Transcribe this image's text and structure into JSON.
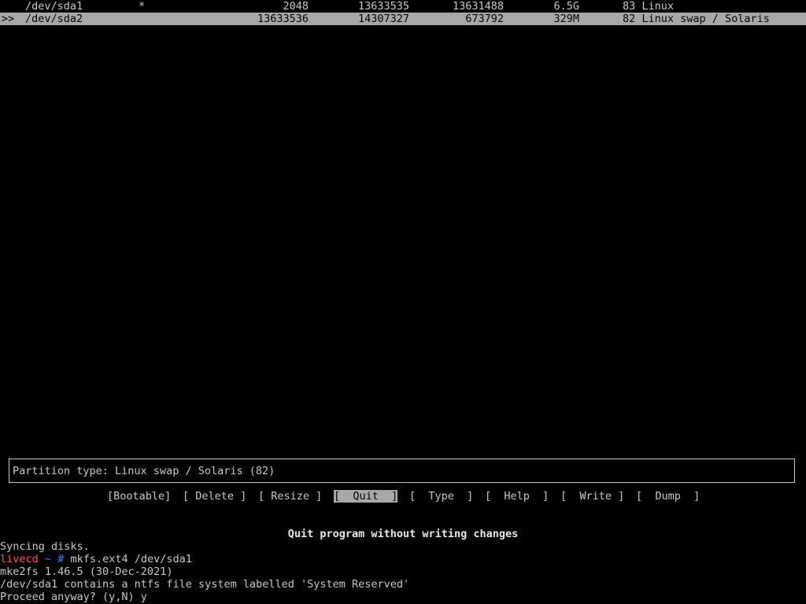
{
  "table": {
    "rows": [
      {
        "cursor": "",
        "device": "/dev/sda1",
        "boot": "*",
        "start": "2048",
        "end": "13633535",
        "sectors": "13631488",
        "size": "6.5G",
        "id_type": "83 Linux",
        "selected": false
      },
      {
        "cursor": ">>",
        "device": "/dev/sda2",
        "boot": "",
        "start": "13633536",
        "end": "14307327",
        "sectors": "673792",
        "size": "329M",
        "id_type": "82 Linux swap / Solaris",
        "selected": true
      }
    ]
  },
  "info": {
    "partition_type": "Partition type: Linux swap / Solaris (82)"
  },
  "menu": {
    "items": [
      {
        "label": "[Bootable]",
        "active": false
      },
      {
        "label": "[ Delete ]",
        "active": false
      },
      {
        "label": "[ Resize ]",
        "active": false
      },
      {
        "label": "[  Quit  ]",
        "active": true
      },
      {
        "label": "[  Type  ]",
        "active": false
      },
      {
        "label": "[  Help  ]",
        "active": false
      },
      {
        "label": "[  Write ]",
        "active": false
      },
      {
        "label": "[  Dump  ]",
        "active": false
      }
    ],
    "hint": "Quit program without writing changes"
  },
  "terminal": {
    "line1": "Syncing disks.",
    "prompt_host": "livecd",
    "prompt_tilde": "~",
    "prompt_hash": "#",
    "command": "mkfs.ext4 /dev/sda1",
    "line3": "mke2fs 1.46.5 (30-Dec-2021)",
    "line4": "/dev/sda1 contains a ntfs file system labelled 'System Reserved'",
    "line5": "Proceed anyway? (y,N) y"
  },
  "colors": {
    "background": "#000000",
    "foreground": "#c8c8c8",
    "highlight": "#a8a8a8",
    "prompt_host": "#ff5555",
    "prompt_symbol": "#5577ff"
  }
}
